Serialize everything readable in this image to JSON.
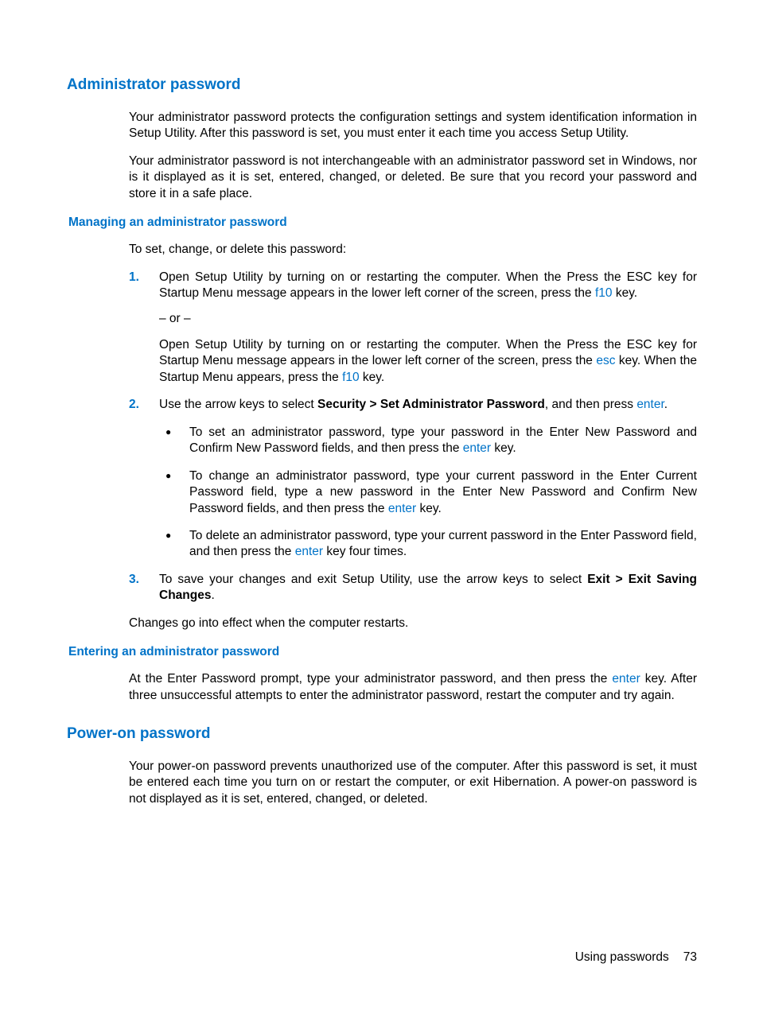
{
  "sec1": {
    "title": "Administrator password",
    "p1": "Your administrator password protects the configuration settings and system identification information in Setup Utility. After this password is set, you must enter it each time you access Setup Utility.",
    "p2": "Your administrator password is not interchangeable with an administrator password set in Windows, nor is it displayed as it is set, entered, changed, or deleted. Be sure that you record your password and store it in a safe place."
  },
  "sec2": {
    "title": "Managing an administrator password",
    "intro": "To set, change, or delete this password:",
    "step1_a": "Open Setup Utility by turning on or restarting the computer. When the Press the ESC key for Startup Menu message appears in the lower left corner of the screen, press the ",
    "step1_f10": "f10",
    "step1_b": " key.",
    "step1_or": "– or –",
    "step1_c": "Open Setup Utility by turning on or restarting the computer. When the Press the ESC key for Startup Menu message appears in the lower left corner of the screen, press the ",
    "step1_esc": "esc",
    "step1_d": " key. When the Startup Menu appears, press the ",
    "step1_f10b": "f10",
    "step1_e": " key.",
    "step2_a": "Use the arrow keys to select ",
    "step2_bold": "Security > Set Administrator Password",
    "step2_b": ", and then press ",
    "step2_enter": "enter",
    "step2_c": ".",
    "bul1_a": "To set an administrator password, type your password in the Enter New Password and Confirm New Password fields, and then press the ",
    "bul1_enter": "enter",
    "bul1_b": " key.",
    "bul2_a": "To change an administrator password, type your current password in the Enter Current Password field, type a new password in the Enter New Password and Confirm New Password fields, and then press the ",
    "bul2_enter": "enter",
    "bul2_b": " key.",
    "bul3_a": "To delete an administrator password, type your current password in the Enter Password field, and then press the ",
    "bul3_enter": "enter",
    "bul3_b": " key four times.",
    "step3_a": "To save your changes and exit Setup Utility, use the arrow keys to select ",
    "step3_bold": "Exit > Exit Saving Changes",
    "step3_b": ".",
    "outro": "Changes go into effect when the computer restarts."
  },
  "sec3": {
    "title": "Entering an administrator password",
    "p1_a": "At the Enter Password prompt, type your administrator password, and then press the ",
    "p1_enter": "enter",
    "p1_b": " key. After three unsuccessful attempts to enter the administrator password, restart the computer and try again."
  },
  "sec4": {
    "title": "Power-on password",
    "p1": "Your power-on password prevents unauthorized use of the computer. After this password is set, it must be entered each time you turn on or restart the computer, or exit Hibernation. A power-on password is not displayed as it is set, entered, changed, or deleted."
  },
  "footer": {
    "chapter": "Using passwords",
    "page": "73"
  },
  "nums": {
    "n1": "1.",
    "n2": "2.",
    "n3": "3."
  }
}
